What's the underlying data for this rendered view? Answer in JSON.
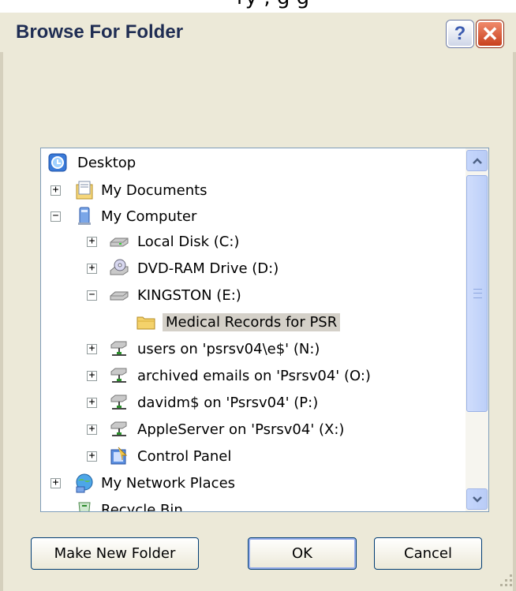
{
  "window": {
    "top_fragment": "ry  ,  g  g",
    "title": "Browse For Folder",
    "help_glyph": "?",
    "close_glyph": "✕"
  },
  "tree": {
    "items": [
      {
        "label": "Desktop",
        "icon": "desktop-icon",
        "expander": ""
      },
      {
        "label": "My Documents",
        "icon": "my-documents-icon",
        "expander": "+"
      },
      {
        "label": "My Computer",
        "icon": "my-computer-icon",
        "expander": "−"
      },
      {
        "label": "Local Disk (C:)",
        "icon": "hard-drive-icon",
        "expander": "+"
      },
      {
        "label": "DVD-RAM Drive (D:)",
        "icon": "dvd-drive-icon",
        "expander": "+"
      },
      {
        "label": "KINGSTON (E:)",
        "icon": "removable-drive-icon",
        "expander": "−"
      },
      {
        "label": "Medical Records for PSR",
        "icon": "folder-icon",
        "expander": "",
        "selected": true
      },
      {
        "label": "users on 'psrsv04\\e$' (N:)",
        "icon": "network-drive-icon",
        "expander": "+"
      },
      {
        "label": "archived emails on 'Psrsv04' (O:)",
        "icon": "network-drive-icon",
        "expander": "+"
      },
      {
        "label": "davidm$ on 'Psrsv04' (P:)",
        "icon": "network-drive-icon",
        "expander": "+"
      },
      {
        "label": "AppleServer on 'Psrsv04' (X:)",
        "icon": "network-drive-icon",
        "expander": "+"
      },
      {
        "label": "Control Panel",
        "icon": "control-panel-icon",
        "expander": "+"
      },
      {
        "label": "My Network Places",
        "icon": "network-places-icon",
        "expander": "+"
      },
      {
        "label": "Recycle Bin",
        "icon": "recycle-bin-icon",
        "expander": ""
      }
    ]
  },
  "buttons": {
    "make_new_folder": "Make New Folder",
    "ok": "OK",
    "cancel": "Cancel"
  },
  "colors": {
    "dialog_bg": "#ece9d8",
    "selection_bg": "#d4d0c8",
    "tree_border": "#7f9db9"
  }
}
